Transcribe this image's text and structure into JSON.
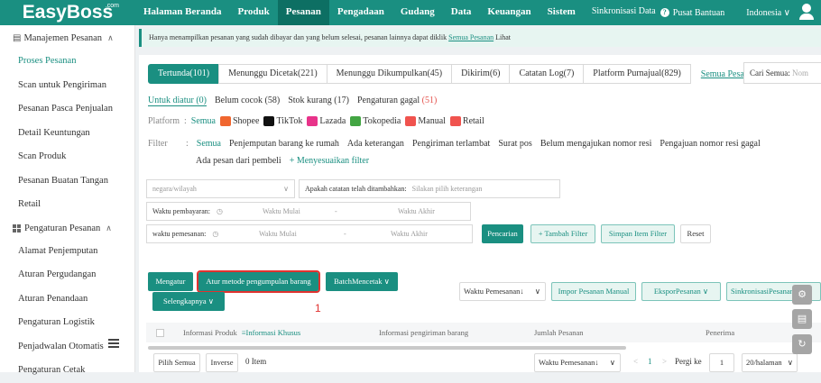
{
  "app": {
    "logo": "EasyBoss",
    "logo_sup": ".com"
  },
  "topnav": {
    "items": [
      "Halaman Beranda",
      "Produk",
      "Pesanan",
      "Pengadaan",
      "Gudang",
      "Data",
      "Keuangan",
      "Sistem"
    ],
    "active": "Pesanan",
    "sync": "Sinkronisasi Data",
    "help": "Pusat Bantuan",
    "language": "Indonesia"
  },
  "sidebar": {
    "group1": "Manajemen Pesanan",
    "items1": [
      "Proses Pesanan",
      "Scan untuk Pengiriman",
      "Pesanan Pasca Penjualan",
      "Detail Keuntungan",
      "Scan Produk",
      "Pesanan Buatan Tangan",
      "Retail"
    ],
    "active": "Proses Pesanan",
    "group2": "Pengaturan Pesanan",
    "items2": [
      "Alamat Penjemputan",
      "Aturan Pergudangan",
      "Aturan Penandaan",
      "Pengaturan Logistik",
      "Penjadwalan Otomatis",
      "Pengaturan Cetak"
    ]
  },
  "notice": {
    "text": "Hanya menampilkan pesanan yang sudah dibayar dan yang belum selesai, pesanan lainnya dapat diklik",
    "link": "Semua Pesanan",
    "suffix": "Lihat"
  },
  "tabs": [
    "Tertunda(101)",
    "Menunggu Dicetak(221)",
    "Menunggu Dikumpulkan(45)",
    "Dikirim(6)",
    "Catatan Log(7)",
    "Platform Purnajual(829)"
  ],
  "tabs_link": "Semua Pesanan",
  "search": {
    "label": "Cari Semua:",
    "placeholder": "Nom"
  },
  "subtabs": {
    "a": "Untuk diatur (0)",
    "b": "Belum cocok (58)",
    "c": "Stok kurang (17)",
    "d_prefix": "Pengaturan gagal",
    "d_count": "(51)"
  },
  "platform": {
    "label": "Platform",
    "all": "Semua",
    "items": [
      "Shopee",
      "TikTok",
      "Lazada",
      "Tokopedia",
      "Manual",
      "Retail"
    ]
  },
  "filter": {
    "label": "Filter",
    "all": "Semua",
    "items": [
      "Penjemputan barang ke rumah",
      "Ada keterangan",
      "Pengiriman terlambat",
      "Surat pos",
      "Belum mengajukan nomor resi",
      "Pengajuan nomor resi gagal"
    ],
    "row2": "Ada pesan dari pembeli",
    "custom": "+ Menyesuaikan filter"
  },
  "form": {
    "region_placeholder": "negara/wilayah",
    "note_label": "Apakah catatan telah ditambahkan:",
    "note_placeholder": "Silakan pilih keterangan",
    "pay_label": "Waktu pembayaran:",
    "order_label": "waktu pemesanan:",
    "start": "Waktu Mulai",
    "end": "Waktu Akhir",
    "dash": "-",
    "btn_search": "Pencarian",
    "btn_add_filter": "+ Tambah Filter",
    "btn_save": "Simpan Item Filter",
    "btn_reset": "Reset"
  },
  "actions": {
    "arrange": "Mengatur",
    "collect_rules": "Atur metode pengumpulan barang",
    "batch_print": "BatchMencetak",
    "more": "Selengkapnya",
    "sort": "Waktu Pemesanan↓",
    "import": "Impor Pesanan Manual",
    "export": "EksporPesanan",
    "sync": "SinkronisasiPesanan",
    "annotation": "1"
  },
  "table": {
    "col1": "Informasi Produk",
    "col1_link": "≡Informasi Khusus",
    "col2": "Informasi pengiriman barang",
    "col3": "Jumlah Pesanan",
    "col4": "Penerima"
  },
  "footer": {
    "select_all": "Pilih Semua",
    "inverse": "Inverse",
    "count": "0 Item",
    "sort": "Waktu Pemesanan↓",
    "page": "1",
    "goto": "Pergi ke",
    "goto_val": "1",
    "per_page": "20/halaman"
  },
  "colors": {
    "brand": "#1a8f81",
    "brand_dark": "#0d6f63",
    "alert": "#e0322f"
  }
}
